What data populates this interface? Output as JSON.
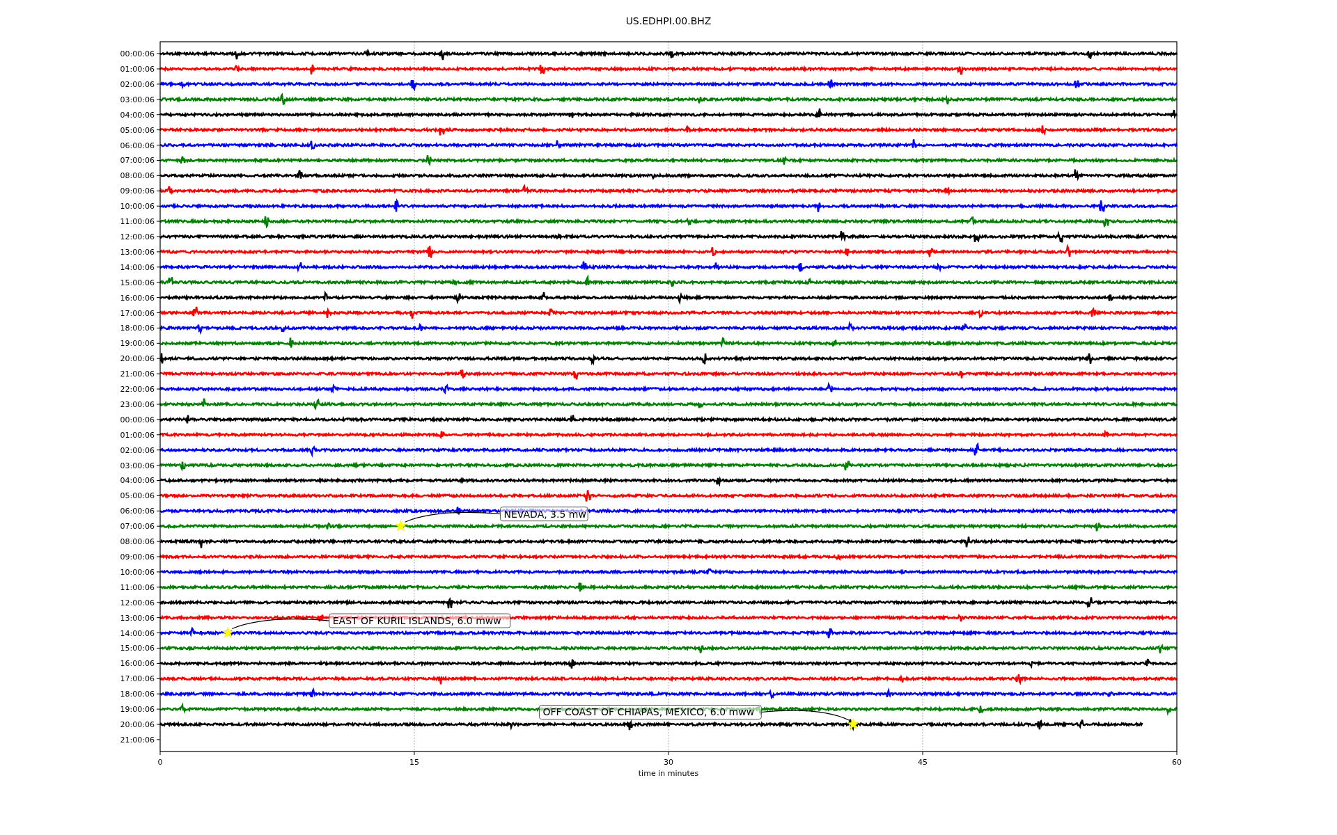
{
  "plot": {
    "title": "US.EDHPI.00.BHZ",
    "xlabel": "time in minutes",
    "x_ticks": [
      "0",
      "15",
      "30",
      "45",
      "60"
    ],
    "row_labels": [
      "00:00:06",
      "01:00:06",
      "02:00:06",
      "03:00:06",
      "04:00:06",
      "05:00:06",
      "06:00:06",
      "07:00:06",
      "08:00:06",
      "09:00:06",
      "10:00:06",
      "11:00:06",
      "12:00:06",
      "13:00:06",
      "14:00:06",
      "15:00:06",
      "16:00:06",
      "17:00:06",
      "18:00:06",
      "19:00:06",
      "20:00:06",
      "21:00:06",
      "22:00:06",
      "23:00:06",
      "00:00:06",
      "01:00:06",
      "02:00:06",
      "03:00:06",
      "04:00:06",
      "05:00:06",
      "06:00:06",
      "07:00:06",
      "08:00:06",
      "09:00:06",
      "10:00:06",
      "11:00:06",
      "12:00:06",
      "13:00:06",
      "14:00:06",
      "15:00:06",
      "16:00:06",
      "17:00:06",
      "18:00:06",
      "19:00:06",
      "20:00:06",
      "21:00:06"
    ],
    "traces": [
      {
        "color": "#000000"
      },
      {
        "color": "#ff0000"
      },
      {
        "color": "#0000ff"
      },
      {
        "color": "#008000"
      },
      {
        "color": "#000000"
      },
      {
        "color": "#ff0000"
      },
      {
        "color": "#0000ff"
      },
      {
        "color": "#008000"
      },
      {
        "color": "#000000"
      },
      {
        "color": "#ff0000"
      },
      {
        "color": "#0000ff"
      },
      {
        "color": "#008000"
      },
      {
        "color": "#000000"
      },
      {
        "color": "#ff0000"
      },
      {
        "color": "#0000ff"
      },
      {
        "color": "#008000"
      },
      {
        "color": "#000000"
      },
      {
        "color": "#ff0000"
      },
      {
        "color": "#0000ff"
      },
      {
        "color": "#008000"
      },
      {
        "color": "#000000"
      },
      {
        "color": "#ff0000"
      },
      {
        "color": "#0000ff"
      },
      {
        "color": "#008000"
      },
      {
        "color": "#000000"
      },
      {
        "color": "#ff0000"
      },
      {
        "color": "#0000ff"
      },
      {
        "color": "#008000"
      },
      {
        "color": "#000000"
      },
      {
        "color": "#ff0000"
      },
      {
        "color": "#0000ff"
      },
      {
        "color": "#008000"
      },
      {
        "color": "#000000"
      },
      {
        "color": "#ff0000"
      },
      {
        "color": "#0000ff"
      },
      {
        "color": "#008000"
      },
      {
        "color": "#000000"
      },
      {
        "color": "#ff0000"
      },
      {
        "color": "#0000ff"
      },
      {
        "color": "#008000"
      },
      {
        "color": "#000000"
      },
      {
        "color": "#ff0000"
      },
      {
        "color": "#0000ff"
      },
      {
        "color": "#008000"
      },
      {
        "color": "#000000"
      }
    ],
    "events": [
      {
        "text": "NEVADA, 3.5 mw"
      },
      {
        "text": "EAST OF KURIL ISLANDS, 6.0 mww"
      },
      {
        "text": "OFF COAST OF CHIAPAS, MEXICO, 6.0 mww"
      }
    ]
  }
}
